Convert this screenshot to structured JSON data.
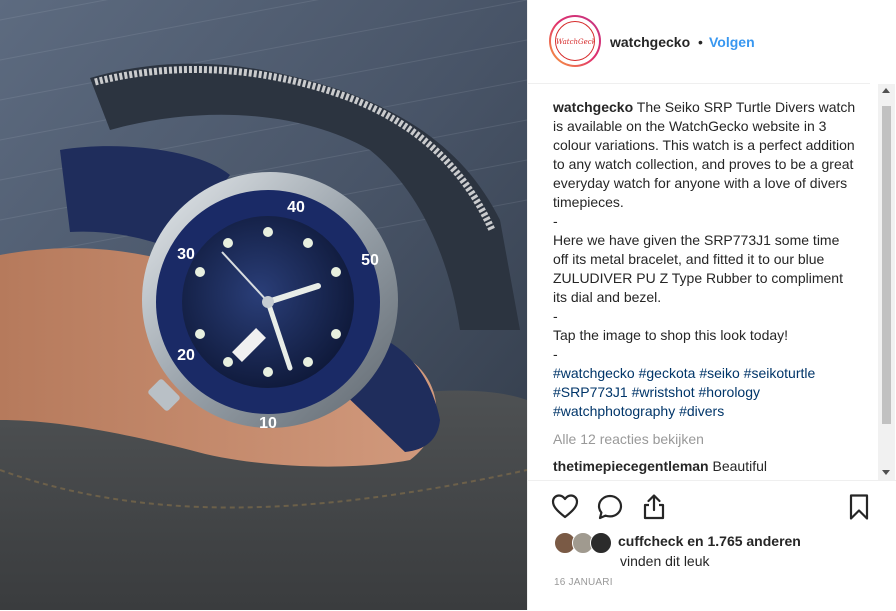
{
  "post": {
    "username": "watchgecko",
    "dot": "•",
    "follow_label": "Volgen",
    "avatar_logo_text": "WatchGecko",
    "caption_user": "watchgecko",
    "caption_text": " The Seiko SRP Turtle Divers watch is available on the WatchGecko website in 3 colour variations. This watch is a perfect addition to any watch collection, and proves to be a great everyday watch for anyone with a love of divers timepieces.\n-\nHere we have given the SRP773J1 some time off its metal bracelet, and fitted it to our blue ZULUDIVER PU Z Type Rubber to compliment its dial and bezel.\n-\nTap the image to shop this look today!\n-\n",
    "hashtags": "#watchgecko #geckota #seiko #seikoturtle #SRP773J1 #wristshot #horology #watchphotography #divers",
    "view_all_comments": "Alle 12 reacties bekijken",
    "comment_user": "thetimepiecegentleman",
    "comment_text": "Beautiful",
    "likes_user": "cuffcheck",
    "likes_rest": " en 1.765 anderen",
    "likes_line2": "vinden dit leuk",
    "date": "16 januari"
  },
  "icons": {
    "like": "heart-outline-icon",
    "comment": "speech-bubble-icon",
    "share": "share-upload-icon",
    "save": "bookmark-icon"
  },
  "colors": {
    "accent": "#3897f0",
    "hashtag": "#003569",
    "muted": "#999999"
  }
}
